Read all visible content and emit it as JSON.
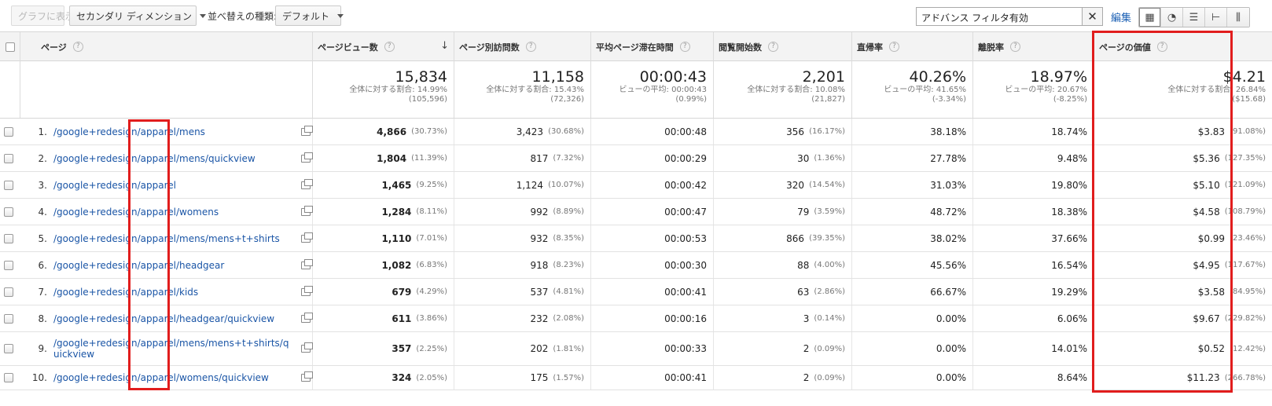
{
  "toolbar": {
    "graph_button": "グラフに表示",
    "secondary_dimension": "セカンダリ ディメンション",
    "sort_type_label": "並べ替えの種類:",
    "sort_value": "デフォルト",
    "filter_value": "アドバンス フィルタ有効",
    "edit_link": "編集",
    "view_icons": [
      "table-icon",
      "pie-icon",
      "bar-icon",
      "comparison-icon",
      "pivot-icon"
    ]
  },
  "table": {
    "headers": [
      "ページ",
      "ページビュー数",
      "ページ別訪問数",
      "平均ページ滞在時間",
      "閲覧開始数",
      "直帰率",
      "離脱率",
      "ページの価値"
    ],
    "totals": [
      {
        "big": "15,834",
        "sub1": "全体に対する割合: 14.99%",
        "sub2": "(105,596)"
      },
      {
        "big": "11,158",
        "sub1": "全体に対する割合: 15.43%",
        "sub2": "(72,326)"
      },
      {
        "big": "00:00:43",
        "sub1": "ビューの平均: 00:00:43",
        "sub2": "(0.99%)"
      },
      {
        "big": "2,201",
        "sub1": "全体に対する割合: 10.08%",
        "sub2": "(21,827)"
      },
      {
        "big": "40.26%",
        "sub1": "ビューの平均: 41.65%",
        "sub2": "(-3.34%)"
      },
      {
        "big": "18.97%",
        "sub1": "ビューの平均: 20.67%",
        "sub2": "(-8.25%)"
      },
      {
        "big": "$4.21",
        "sub1": "全体に対する割合: 26.84%",
        "sub2": "($15.68)"
      }
    ],
    "rows": [
      {
        "num": "1.",
        "page": "/google+redesign/apparel/mens",
        "pv": "4,866",
        "pv_pct": "(30.73%)",
        "uv": "3,423",
        "uv_pct": "(30.68%)",
        "time": "00:00:48",
        "entr": "356",
        "entr_pct": "(16.17%)",
        "bounce": "38.18%",
        "exit": "18.74%",
        "value": "$3.83",
        "value_pct": "(91.08%)"
      },
      {
        "num": "2.",
        "page": "/google+redesign/apparel/mens/quickview",
        "pv": "1,804",
        "pv_pct": "(11.39%)",
        "uv": "817",
        "uv_pct": "(7.32%)",
        "time": "00:00:29",
        "entr": "30",
        "entr_pct": "(1.36%)",
        "bounce": "27.78%",
        "exit": "9.48%",
        "value": "$5.36",
        "value_pct": "(127.35%)"
      },
      {
        "num": "3.",
        "page": "/google+redesign/apparel",
        "pv": "1,465",
        "pv_pct": "(9.25%)",
        "uv": "1,124",
        "uv_pct": "(10.07%)",
        "time": "00:00:42",
        "entr": "320",
        "entr_pct": "(14.54%)",
        "bounce": "31.03%",
        "exit": "19.80%",
        "value": "$5.10",
        "value_pct": "(121.09%)"
      },
      {
        "num": "4.",
        "page": "/google+redesign/apparel/womens",
        "pv": "1,284",
        "pv_pct": "(8.11%)",
        "uv": "992",
        "uv_pct": "(8.89%)",
        "time": "00:00:47",
        "entr": "79",
        "entr_pct": "(3.59%)",
        "bounce": "48.72%",
        "exit": "18.38%",
        "value": "$4.58",
        "value_pct": "(108.79%)"
      },
      {
        "num": "5.",
        "page": "/google+redesign/apparel/mens/mens+t+shirts",
        "pv": "1,110",
        "pv_pct": "(7.01%)",
        "uv": "932",
        "uv_pct": "(8.35%)",
        "time": "00:00:53",
        "entr": "866",
        "entr_pct": "(39.35%)",
        "bounce": "38.02%",
        "exit": "37.66%",
        "value": "$0.99",
        "value_pct": "(23.46%)"
      },
      {
        "num": "6.",
        "page": "/google+redesign/apparel/headgear",
        "pv": "1,082",
        "pv_pct": "(6.83%)",
        "uv": "918",
        "uv_pct": "(8.23%)",
        "time": "00:00:30",
        "entr": "88",
        "entr_pct": "(4.00%)",
        "bounce": "45.56%",
        "exit": "16.54%",
        "value": "$4.95",
        "value_pct": "(117.67%)"
      },
      {
        "num": "7.",
        "page": "/google+redesign/apparel/kids",
        "pv": "679",
        "pv_pct": "(4.29%)",
        "uv": "537",
        "uv_pct": "(4.81%)",
        "time": "00:00:41",
        "entr": "63",
        "entr_pct": "(2.86%)",
        "bounce": "66.67%",
        "exit": "19.29%",
        "value": "$3.58",
        "value_pct": "(84.95%)"
      },
      {
        "num": "8.",
        "page": "/google+redesign/apparel/headgear/quickview",
        "pv": "611",
        "pv_pct": "(3.86%)",
        "uv": "232",
        "uv_pct": "(2.08%)",
        "time": "00:00:16",
        "entr": "3",
        "entr_pct": "(0.14%)",
        "bounce": "0.00%",
        "exit": "6.06%",
        "value": "$9.67",
        "value_pct": "(229.82%)"
      },
      {
        "num": "9.",
        "page": "/google+redesign/apparel/mens/mens+t+shirts/quickview",
        "pv": "357",
        "pv_pct": "(2.25%)",
        "uv": "202",
        "uv_pct": "(1.81%)",
        "time": "00:00:33",
        "entr": "2",
        "entr_pct": "(0.09%)",
        "bounce": "0.00%",
        "exit": "14.01%",
        "value": "$0.52",
        "value_pct": "(12.42%)"
      },
      {
        "num": "10.",
        "page": "/google+redesign/apparel/womens/quickview",
        "pv": "324",
        "pv_pct": "(2.05%)",
        "uv": "175",
        "uv_pct": "(1.57%)",
        "time": "00:00:41",
        "entr": "2",
        "entr_pct": "(0.09%)",
        "bounce": "0.00%",
        "exit": "8.64%",
        "value": "$11.23",
        "value_pct": "(266.78%)"
      }
    ]
  },
  "highlight_color": "#e11d1d",
  "link_color": "#1a55a6"
}
